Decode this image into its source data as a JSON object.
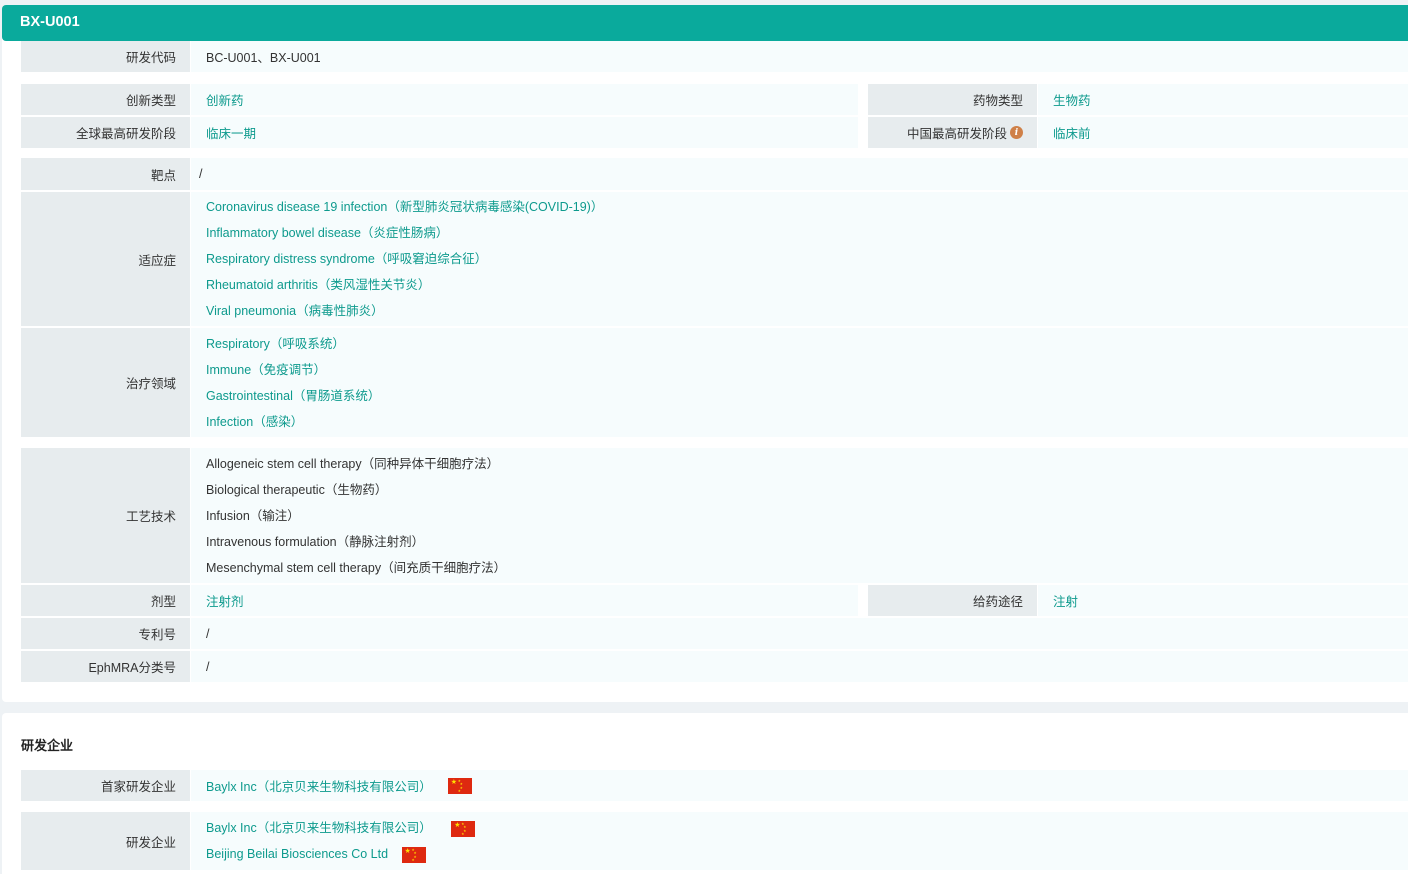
{
  "header": {
    "title": "BX-U001"
  },
  "basic": {
    "rd_code_label": "研发代码",
    "rd_code_value": "BC-U001、BX-U001",
    "innovation_label": "创新类型",
    "innovation_value": "创新药",
    "drug_type_label": "药物类型",
    "drug_type_value": "生物药",
    "global_stage_label": "全球最高研发阶段",
    "global_stage_value": "临床一期",
    "china_stage_label": "中国最高研发阶段",
    "china_stage_value": "临床前",
    "info_glyph": "i",
    "target_label": "靶点",
    "target_value": "/",
    "indication_label": "适应症",
    "indications": [
      "Coronavirus disease 19 infection（新型肺炎冠状病毒感染(COVID-19)）",
      "Inflammatory bowel disease（炎症性肠病）",
      "Respiratory distress syndrome（呼吸窘迫综合征）",
      "Rheumatoid arthritis（类风湿性关节炎）",
      "Viral pneumonia（病毒性肺炎）"
    ],
    "therapy_label": "治疗领域",
    "therapy_areas": [
      "Respiratory（呼吸系统）",
      "Immune（免疫调节）",
      "Gastrointestinal（胃肠道系统）",
      "Infection（感染）"
    ],
    "tech_label": "工艺技术",
    "techs": [
      "Allogeneic stem cell therapy（同种异体干细胞疗法）",
      "Biological therapeutic（生物药）",
      "Infusion（输注）",
      "Intravenous formulation（静脉注射剂）",
      "Mesenchymal stem cell therapy（间充质干细胞疗法）"
    ],
    "dosage_label": "剂型",
    "dosage_value": "注射剂",
    "route_label": "给药途径",
    "route_value": "注射",
    "patent_label": "专利号",
    "patent_value": "/",
    "ephmra_label": "EphMRA分类号",
    "ephmra_value": "/"
  },
  "companies": {
    "section_title": "研发企业",
    "first_label": "首家研发企业",
    "first_value": "Baylx Inc（北京贝来生物科技有限公司）",
    "rd_label": "研发企业",
    "rd_values": [
      "Baylx Inc（北京贝来生物科技有限公司）",
      "Beijing Beilai Biosciences Co Ltd"
    ]
  },
  "colors": {
    "accent": "#0aaa9c",
    "link": "#0d9a8d",
    "label_bg": "#e7ecee",
    "value_bg": "#f6fcfd",
    "flag_red": "#de2910",
    "flag_yellow": "#ffde00"
  },
  "icons": {
    "info": "info-icon",
    "flag": "china-flag-icon"
  }
}
